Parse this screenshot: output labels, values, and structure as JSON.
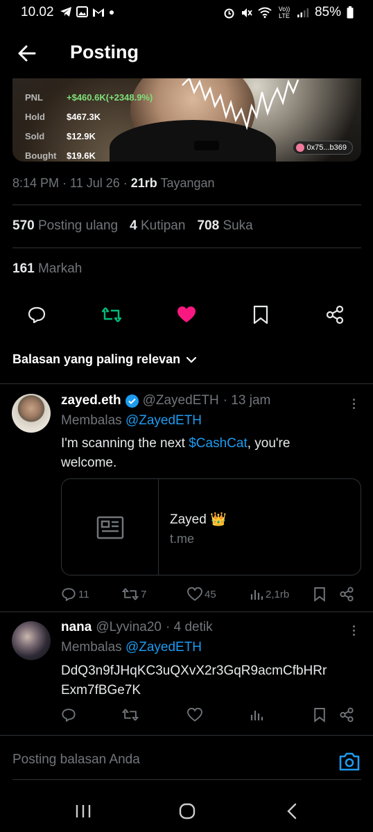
{
  "status_bar": {
    "time": "10.02",
    "battery": "85%",
    "lte": "Vo)) LTE"
  },
  "header": {
    "title": "Posting"
  },
  "media": {
    "stats": [
      {
        "label": "PNL",
        "value": "+$460.6K(+2348.9%)"
      },
      {
        "label": "Hold",
        "value": "$467.3K"
      },
      {
        "label": "Sold",
        "value": "$12.9K"
      },
      {
        "label": "Bought",
        "value": "$19.6K"
      }
    ],
    "wallet": "0x75...b369"
  },
  "post_meta": {
    "time": "8:14 PM",
    "date": "11 Jul 26",
    "views_count": "21rb",
    "views_label": "Tayangan"
  },
  "counts": {
    "reposts": "570",
    "reposts_label": "Posting ulang",
    "quotes": "4",
    "quotes_label": "Kutipan",
    "likes": "708",
    "likes_label": "Suka",
    "bookmarks": "161",
    "bookmarks_label": "Markah"
  },
  "sort": {
    "label": "Balasan yang paling relevan"
  },
  "replies": [
    {
      "name": "zayed.eth",
      "handle": "@ZayedETH",
      "time": "· 13 jam",
      "replying_label": "Membalas",
      "replying_to": "@ZayedETH",
      "text_before": "I'm scanning the next",
      "text_cashtag": "$CashCat",
      "text_after": ", you're",
      "text_line2": "welcome.",
      "link_title": "Zayed 👑",
      "link_domain": "t.me",
      "reply_count": "11",
      "repost_count": "7",
      "like_count": "45",
      "view_count": "2,1rb"
    },
    {
      "name": "nana",
      "handle": "@Lyvina20",
      "time": "· 4 detik",
      "replying_label": "Membalas",
      "replying_to": "@ZayedETH",
      "text_line1": "DdQ3n9fJHqKC3uQXvX2r3GqR9acmCfbHRr",
      "text_line2": "Exm7fBGe7K"
    }
  ],
  "compose": {
    "placeholder": "Posting balasan Anda"
  },
  "colors": {
    "accent": "#1d9bf0",
    "repost_active": "#00ba7c",
    "like_active": "#f91880",
    "muted": "#71767b"
  }
}
